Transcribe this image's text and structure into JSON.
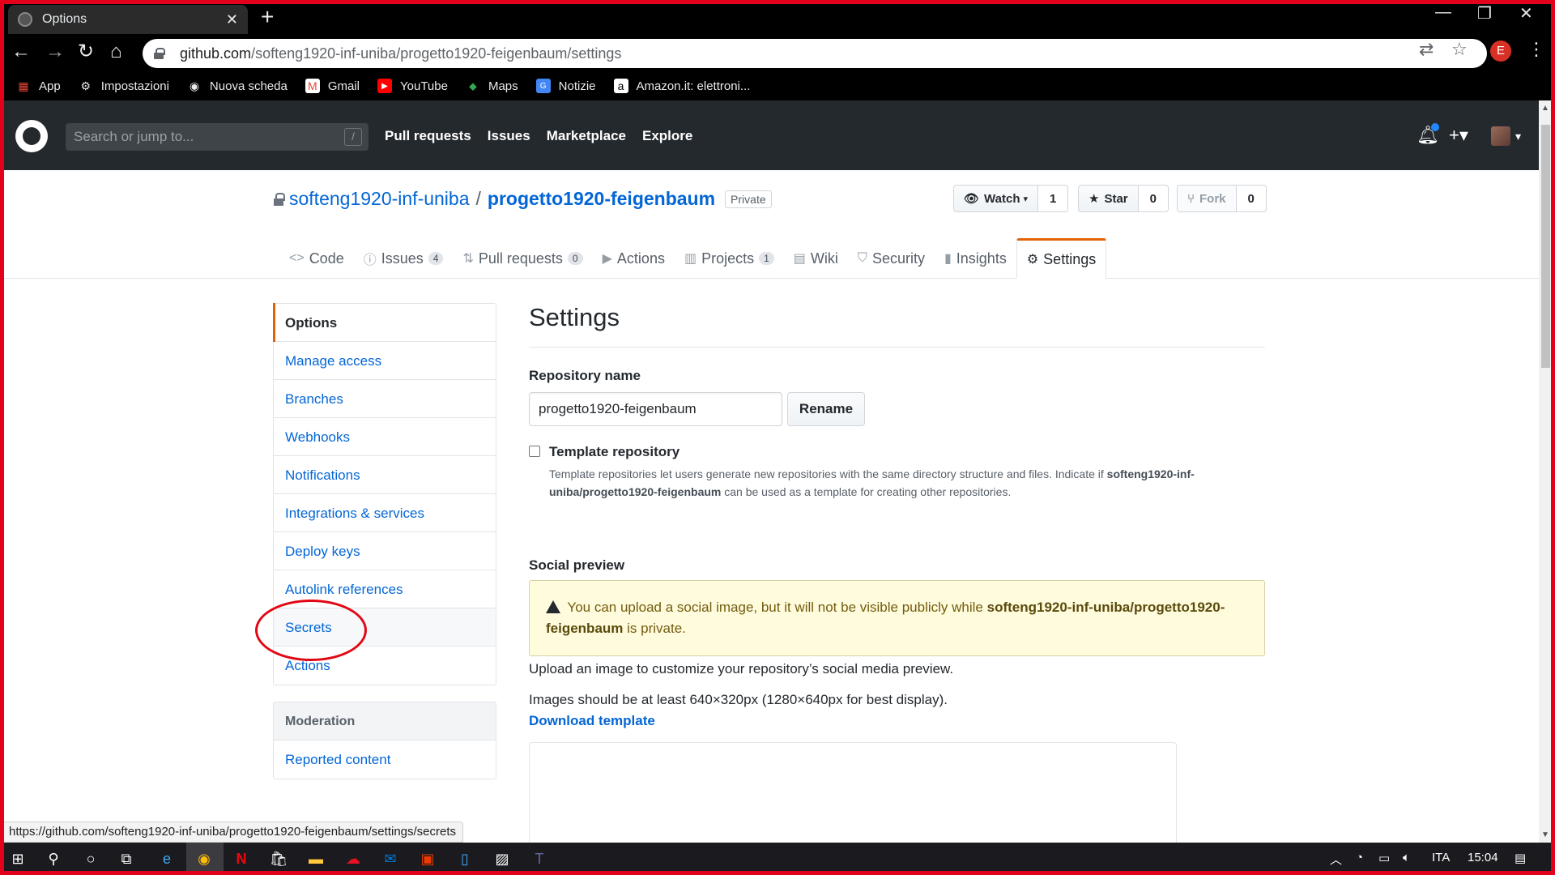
{
  "browser": {
    "tab_title": "Options",
    "url_host": "github.com",
    "url_path": "/softeng1920-inf-uniba/progetto1920-feigenbaum/settings",
    "profile_letter": "E",
    "bookmarks": [
      {
        "label": "App",
        "icon": "apps-grid-icon"
      },
      {
        "label": "Impostazioni",
        "icon": "gear-icon"
      },
      {
        "label": "Nuova scheda",
        "icon": "chrome-icon"
      },
      {
        "label": "Gmail",
        "icon": "gmail-icon"
      },
      {
        "label": "YouTube",
        "icon": "youtube-icon"
      },
      {
        "label": "Maps",
        "icon": "maps-icon"
      },
      {
        "label": "Notizie",
        "icon": "news-icon"
      },
      {
        "label": "Amazon.it: elettroni...",
        "icon": "amazon-icon"
      }
    ],
    "status_url": "https://github.com/softeng1920-inf-uniba/progetto1920-feigenbaum/settings/secrets"
  },
  "gh_header": {
    "search_placeholder": "Search or jump to...",
    "search_shortcut": "/",
    "nav": [
      "Pull requests",
      "Issues",
      "Marketplace",
      "Explore"
    ]
  },
  "repo": {
    "owner": "softeng1920-inf-uniba",
    "separator": "/",
    "name": "progetto1920-feigenbaum",
    "visibility": "Private",
    "watch_label": "Watch",
    "watch_count": "1",
    "star_label": "Star",
    "star_count": "0",
    "fork_label": "Fork",
    "fork_count": "0",
    "tabs": [
      {
        "label": "Code",
        "count": ""
      },
      {
        "label": "Issues",
        "count": "4"
      },
      {
        "label": "Pull requests",
        "count": "0"
      },
      {
        "label": "Actions",
        "count": ""
      },
      {
        "label": "Projects",
        "count": "1"
      },
      {
        "label": "Wiki",
        "count": ""
      },
      {
        "label": "Security",
        "count": ""
      },
      {
        "label": "Insights",
        "count": ""
      },
      {
        "label": "Settings",
        "count": ""
      }
    ]
  },
  "settings_menu": {
    "items": [
      "Options",
      "Manage access",
      "Branches",
      "Webhooks",
      "Notifications",
      "Integrations & services",
      "Deploy keys",
      "Autolink references",
      "Secrets",
      "Actions"
    ],
    "moderation_heading": "Moderation",
    "moderation_items": [
      "Reported content"
    ]
  },
  "main": {
    "title": "Settings",
    "repo_name_label": "Repository name",
    "repo_name_value": "progetto1920-feigenbaum",
    "rename_button": "Rename",
    "template_label": "Template repository",
    "template_note_1": "Template repositories let users generate new repositories with the same directory structure and files. Indicate if",
    "template_note_repo": "softeng1920-inf-uniba/progetto1920-feigenbaum",
    "template_note_2": "can be used as a template for creating other repositories.",
    "social_heading": "Social preview",
    "warn_1": "You can upload a social image, but it will not be visible publicly while",
    "warn_repo": "softeng1920-inf-uniba/progetto1920-feigenbaum",
    "warn_2": "is private.",
    "upload_text": "Upload an image to customize your repository’s social media preview.",
    "size_text": "Images should be at least 640×320px (1280×640px for best display).",
    "download_link": "Download template"
  },
  "taskbar": {
    "language": "ITA",
    "time": "15:04"
  },
  "colors": {
    "frame": "#e3001b",
    "gh_header": "#24292e",
    "link": "#0366d6",
    "selected_accent": "#e36209",
    "annotation": "#e30613"
  }
}
